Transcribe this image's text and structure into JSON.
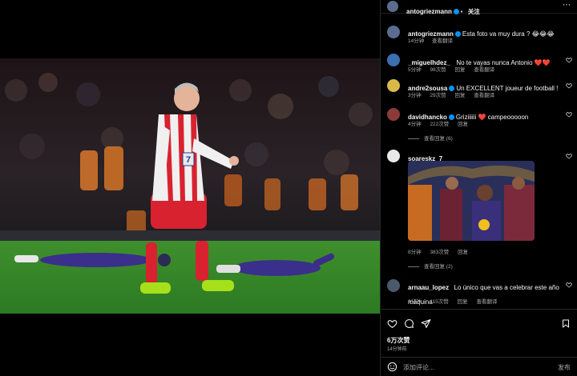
{
  "post": {
    "author": "antogriezmann",
    "follow_label": "关注",
    "more_icon": "ellipsis-icon"
  },
  "caption": {
    "user": "antogriezmann",
    "text": "Esta foto va muy dura ? 😂😂😂",
    "time": "14分钟",
    "translate": "查看翻译"
  },
  "comments": [
    {
      "user": "_miguelhdez_",
      "text": "No te vayas nunca Antonio ❤️❤️",
      "time": "5分钟",
      "likes": "98次赞",
      "reply": "回复",
      "translate": "查看翻译"
    },
    {
      "user": "andre2sousa",
      "text": "Un EXCELLENT joueur de football !",
      "time": "3分钟",
      "likes": "29次赞",
      "reply": "回复",
      "translate": "查看翻译"
    },
    {
      "user": "davidhancko",
      "text": "Griziiiiii ❤️ campeooooon",
      "time": "4分钟",
      "likes": "222次赞",
      "reply": "回复",
      "replies": "查看回复 (6)"
    },
    {
      "user": "soareskz_7",
      "text": "",
      "time": "8分钟",
      "likes": "383次赞",
      "reply": "回复",
      "replies": "查看回复 (2)"
    },
    {
      "user": "arnaau_lopez",
      "text": "Lo único que vas a celebrar este año máquina",
      "time": "3分钟",
      "likes": "115次赞",
      "reply": "回复",
      "translate": "查看翻译"
    }
  ],
  "actions": {
    "likes": "6万次赞",
    "posted": "14分钟前"
  },
  "composer": {
    "placeholder": "添加评论...",
    "post_label": "发布"
  },
  "photo": {
    "jersey_number": "7"
  },
  "colors": {
    "accent": "#0095f6",
    "heart": "#ff3040",
    "background": "#000000"
  }
}
